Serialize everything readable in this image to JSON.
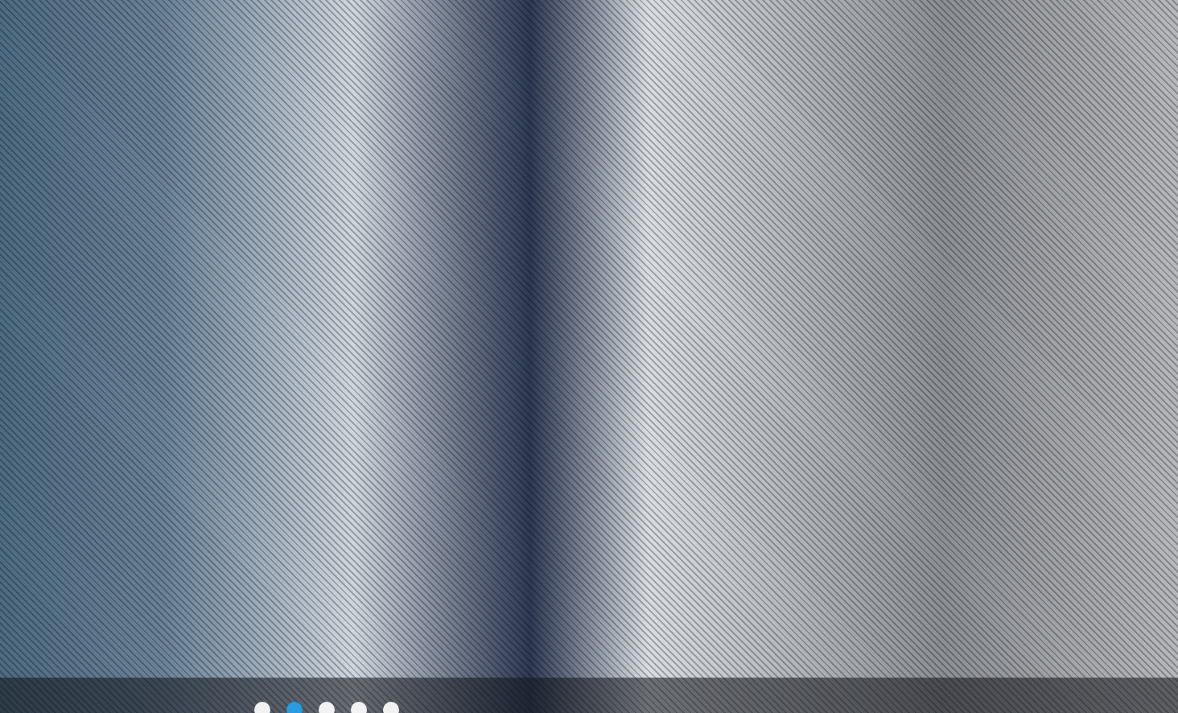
{
  "slider": {
    "slides": [
      {
        "selected": false
      },
      {
        "selected": true
      },
      {
        "selected": false
      },
      {
        "selected": false
      },
      {
        "selected": false
      }
    ]
  }
}
